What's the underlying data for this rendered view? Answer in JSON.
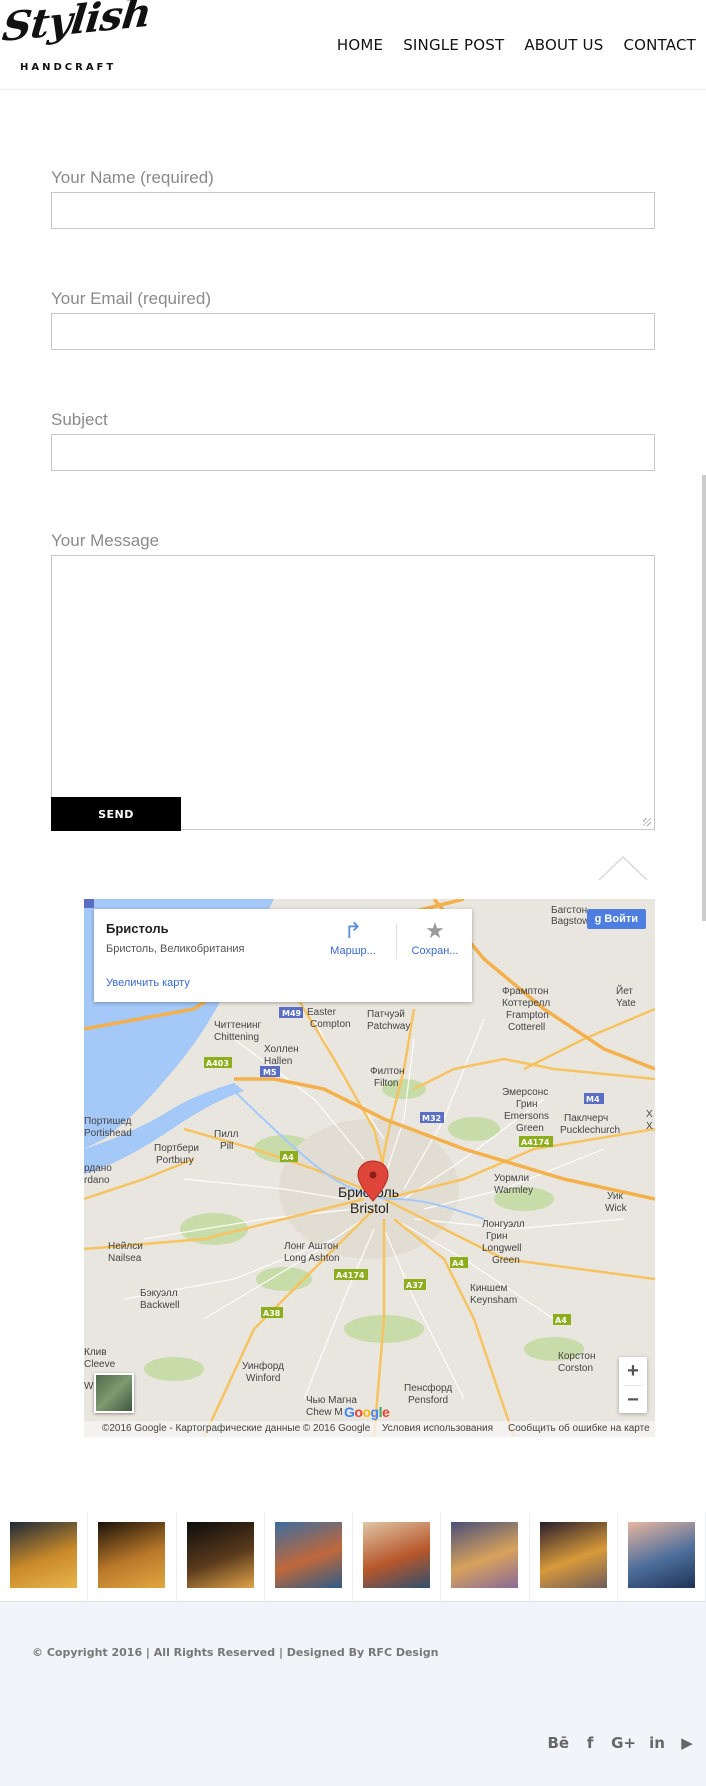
{
  "header": {
    "logo_script": "Stylish",
    "logo_sub": "HANDCRAFT",
    "nav": [
      "HOME",
      "SINGLE POST",
      "ABOUT US",
      "CONTACT"
    ]
  },
  "form": {
    "name_label": "Your Name (required)",
    "email_label": "Your Email (required)",
    "subject_label": "Subject",
    "message_label": "Your Message",
    "name_value": "",
    "email_value": "",
    "subject_value": "",
    "message_value": "",
    "send_label": "SEND"
  },
  "map": {
    "card": {
      "title": "Бристоль",
      "address": "Бристоль, Великобритания",
      "enlarge_link": "Увеличить карту",
      "directions_label": "Маршр...",
      "save_label": "Сохран..."
    },
    "signin_label": "Войти",
    "zoom_in": "+",
    "zoom_out": "−",
    "city_label_ru": "Бристоль",
    "city_label_en": "Bristol",
    "footer": {
      "copyright": "©2016 Google - Картографические данные © 2016 Google",
      "terms": "Условия использования",
      "report": "Сообщить об ошибке на карте"
    },
    "google_logo": "Google",
    "places": [
      "Бэгстон Bagstow",
      "Фрамптон Коттерелл Frampton Cotterell",
      "Йет Yate",
      "Читтенинг Chittening",
      "Истер Compton",
      "Патчуэй Patchway",
      "Холлен Hallen",
      "Филтон Filton",
      "Эмерсонс Грин Emersons Green",
      "Портишед Portishead",
      "Портбери Portbury",
      "Пилл Pill",
      "Паклчерч Pucklechurch",
      "Урмли Warmley",
      "Уик Wick",
      "Лонг Аштон Long Ashton",
      "Нейлси Nailsea",
      "Лонгуэлл Грин Longwell Green",
      "Киншем Keynsham",
      "Бэкуэлл Backwell",
      "Клив Cleeve",
      "Уинфорд Winford",
      "Корстон Corston",
      "Пенсфорд Pensford",
      "Чью Магна Chew Magna",
      "Wrington"
    ],
    "roads": [
      "M49",
      "M5",
      "A403",
      "A4",
      "M32",
      "M4",
      "A4174",
      "A37",
      "A38"
    ]
  },
  "gallery": {
    "count": 8,
    "palettes": [
      [
        "#1c2a3a",
        "#c98a2a",
        "#e8b54c"
      ],
      [
        "#1a1208",
        "#b9782a",
        "#e0a840"
      ],
      [
        "#0c0c0c",
        "#5a3a1c",
        "#e0a34a"
      ],
      [
        "#3b6da0",
        "#c0683b",
        "#2d5c88"
      ],
      [
        "#dfc6a6",
        "#b8572b",
        "#2f4f6e"
      ],
      [
        "#4a4f7a",
        "#d8a25c",
        "#8a6a9a"
      ],
      [
        "#281e2c",
        "#d89a3a",
        "#6f5c5a"
      ],
      [
        "#e8b6a0",
        "#4d6e9c",
        "#1e3356"
      ]
    ]
  },
  "footer": {
    "copyright": "© Copyright 2016 | All Rights Reserved | Designed By RFC Design",
    "social": [
      {
        "icon": "behance-icon",
        "glyph": "Bē"
      },
      {
        "icon": "facebook-icon",
        "glyph": "f"
      },
      {
        "icon": "google-plus-icon",
        "glyph": "G+"
      },
      {
        "icon": "linkedin-icon",
        "glyph": "in"
      },
      {
        "icon": "youtube-icon",
        "glyph": "▶"
      }
    ]
  },
  "colors": {
    "map_water": "#a4c8f8",
    "map_land": "#e9e6df",
    "map_road_major": "#f6c360",
    "map_road_minor": "#ffffff",
    "map_park": "#c7dca8",
    "pin": "#e0453a",
    "button": "#000000",
    "link": "#3a6ad0",
    "footer_bg": "#f1f4f8"
  }
}
